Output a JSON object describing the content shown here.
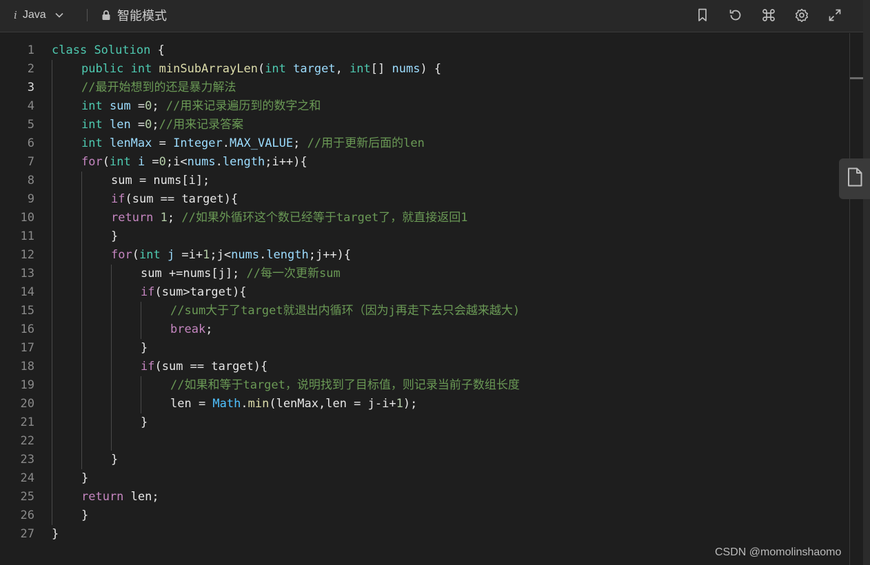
{
  "toolbar": {
    "info_glyph": "i",
    "language": "Java",
    "mode_label": "智能模式",
    "icons": [
      "bookmark-icon",
      "reset-icon",
      "command-icon",
      "settings-icon",
      "fullscreen-icon",
      "chevron-down-icon",
      "lock-icon"
    ]
  },
  "editor": {
    "active_line": 3,
    "lines": [
      {
        "n": "1",
        "indent": 0,
        "tokens": [
          [
            "class",
            "kw"
          ],
          [
            " ",
            "pl"
          ],
          [
            "Solution",
            "cls"
          ],
          [
            " {",
            "pl"
          ]
        ]
      },
      {
        "n": "2",
        "indent": 1,
        "tokens": [
          [
            "public",
            "kw"
          ],
          [
            " ",
            "pl"
          ],
          [
            "int",
            "type"
          ],
          [
            " ",
            "pl"
          ],
          [
            "minSubArrayLen",
            "fn"
          ],
          [
            "(",
            "pl"
          ],
          [
            "int",
            "type"
          ],
          [
            " ",
            "pl"
          ],
          [
            "target",
            "var"
          ],
          [
            ", ",
            "pl"
          ],
          [
            "int",
            "type"
          ],
          [
            "[] ",
            "pl"
          ],
          [
            "nums",
            "var"
          ],
          [
            ") {",
            "pl"
          ]
        ]
      },
      {
        "n": "3",
        "indent": 1,
        "tokens": [
          [
            "//最开始想到的还是暴力解法",
            "cm"
          ]
        ]
      },
      {
        "n": "4",
        "indent": 1,
        "tokens": [
          [
            "int",
            "type"
          ],
          [
            " ",
            "pl"
          ],
          [
            "sum",
            "var"
          ],
          [
            " =",
            "pl"
          ],
          [
            "0",
            "num"
          ],
          [
            "; ",
            "pl"
          ],
          [
            "//用来记录遍历到的数字之和",
            "cm"
          ]
        ]
      },
      {
        "n": "5",
        "indent": 1,
        "tokens": [
          [
            "int",
            "type"
          ],
          [
            " ",
            "pl"
          ],
          [
            "len",
            "var"
          ],
          [
            " =",
            "pl"
          ],
          [
            "0",
            "num"
          ],
          [
            ";",
            "pl"
          ],
          [
            "//用来记录答案",
            "cm"
          ]
        ]
      },
      {
        "n": "6",
        "indent": 1,
        "tokens": [
          [
            "int",
            "type"
          ],
          [
            " ",
            "pl"
          ],
          [
            "lenMax",
            "var"
          ],
          [
            " = ",
            "pl"
          ],
          [
            "Integer",
            "var"
          ],
          [
            ".",
            "pl"
          ],
          [
            "MAX_VALUE",
            "var"
          ],
          [
            "; ",
            "pl"
          ],
          [
            "//用于更新后面的len",
            "cm"
          ]
        ]
      },
      {
        "n": "7",
        "indent": 1,
        "tokens": [
          [
            "for",
            "ctrl"
          ],
          [
            "(",
            "pl"
          ],
          [
            "int",
            "type"
          ],
          [
            " ",
            "pl"
          ],
          [
            "i",
            "var"
          ],
          [
            " =",
            "pl"
          ],
          [
            "0",
            "num"
          ],
          [
            ";i<",
            "pl"
          ],
          [
            "nums",
            "var"
          ],
          [
            ".",
            "pl"
          ],
          [
            "length",
            "prop"
          ],
          [
            ";i++){",
            "pl"
          ]
        ]
      },
      {
        "n": "8",
        "indent": 2,
        "tokens": [
          [
            "sum = nums[i];",
            "pl"
          ]
        ]
      },
      {
        "n": "9",
        "indent": 2,
        "tokens": [
          [
            "if",
            "ctrl"
          ],
          [
            "(sum == target){",
            "pl"
          ]
        ]
      },
      {
        "n": "10",
        "indent": 2,
        "tokens": [
          [
            "return",
            "ctrl"
          ],
          [
            " ",
            "pl"
          ],
          [
            "1",
            "num"
          ],
          [
            "; ",
            "pl"
          ],
          [
            "//如果外循环这个数已经等于target了，就直接返回1",
            "cm"
          ]
        ]
      },
      {
        "n": "11",
        "indent": 2,
        "tokens": [
          [
            "}",
            "pl"
          ]
        ]
      },
      {
        "n": "12",
        "indent": 2,
        "tokens": [
          [
            "for",
            "ctrl"
          ],
          [
            "(",
            "pl"
          ],
          [
            "int",
            "type"
          ],
          [
            " ",
            "pl"
          ],
          [
            "j",
            "var"
          ],
          [
            " =i+",
            "pl"
          ],
          [
            "1",
            "num"
          ],
          [
            ";j<",
            "pl"
          ],
          [
            "nums",
            "var"
          ],
          [
            ".",
            "pl"
          ],
          [
            "length",
            "prop"
          ],
          [
            ";j++){",
            "pl"
          ]
        ]
      },
      {
        "n": "13",
        "indent": 3,
        "tokens": [
          [
            "sum +=nums[j]; ",
            "pl"
          ],
          [
            "//每一次更新sum",
            "cm"
          ]
        ]
      },
      {
        "n": "14",
        "indent": 3,
        "tokens": [
          [
            "if",
            "ctrl"
          ],
          [
            "(sum>target){",
            "pl"
          ]
        ]
      },
      {
        "n": "15",
        "indent": 4,
        "tokens": [
          [
            "//sum大于了target就退出内循环（因为j再走下去只会越来越大)",
            "cm"
          ]
        ]
      },
      {
        "n": "16",
        "indent": 4,
        "tokens": [
          [
            "break",
            "ctrl"
          ],
          [
            ";",
            "pl"
          ]
        ]
      },
      {
        "n": "17",
        "indent": 3,
        "tokens": [
          [
            "}",
            "pl"
          ]
        ]
      },
      {
        "n": "18",
        "indent": 3,
        "tokens": [
          [
            "if",
            "ctrl"
          ],
          [
            "(sum == target){",
            "pl"
          ]
        ]
      },
      {
        "n": "19",
        "indent": 4,
        "tokens": [
          [
            "//如果和等于target，说明找到了目标值，则记录当前子数组长度",
            "cm"
          ]
        ]
      },
      {
        "n": "20",
        "indent": 4,
        "tokens": [
          [
            "len = ",
            "pl"
          ],
          [
            "Math",
            "const"
          ],
          [
            ".",
            "pl"
          ],
          [
            "min",
            "fn"
          ],
          [
            "(lenMax,len = j-i+",
            "pl"
          ],
          [
            "1",
            "num"
          ],
          [
            ");",
            "pl"
          ]
        ]
      },
      {
        "n": "21",
        "indent": 3,
        "tokens": [
          [
            "}",
            "pl"
          ]
        ]
      },
      {
        "n": "22",
        "indent": 3,
        "tokens": []
      },
      {
        "n": "23",
        "indent": 2,
        "tokens": [
          [
            "}",
            "pl"
          ]
        ]
      },
      {
        "n": "24",
        "indent": 1,
        "tokens": [
          [
            "}",
            "pl"
          ]
        ]
      },
      {
        "n": "25",
        "indent": 1,
        "tokens": [
          [
            "return",
            "ctrl"
          ],
          [
            " len;",
            "pl"
          ]
        ]
      },
      {
        "n": "26",
        "indent": 1,
        "tokens": [
          [
            "}",
            "pl"
          ]
        ]
      },
      {
        "n": "27",
        "indent": 0,
        "tokens": [
          [
            "}",
            "pl"
          ]
        ]
      }
    ],
    "guides": [
      {
        "level": 1,
        "from": 2,
        "to": 26
      },
      {
        "level": 2,
        "from": 8,
        "to": 23
      },
      {
        "level": 3,
        "from": 13,
        "to": 22
      },
      {
        "level": 4,
        "from": 15,
        "to": 16
      },
      {
        "level": 4,
        "from": 19,
        "to": 20
      }
    ]
  },
  "side_button": {
    "icon": "file-icon"
  },
  "watermark": "CSDN @momolinshaomo"
}
